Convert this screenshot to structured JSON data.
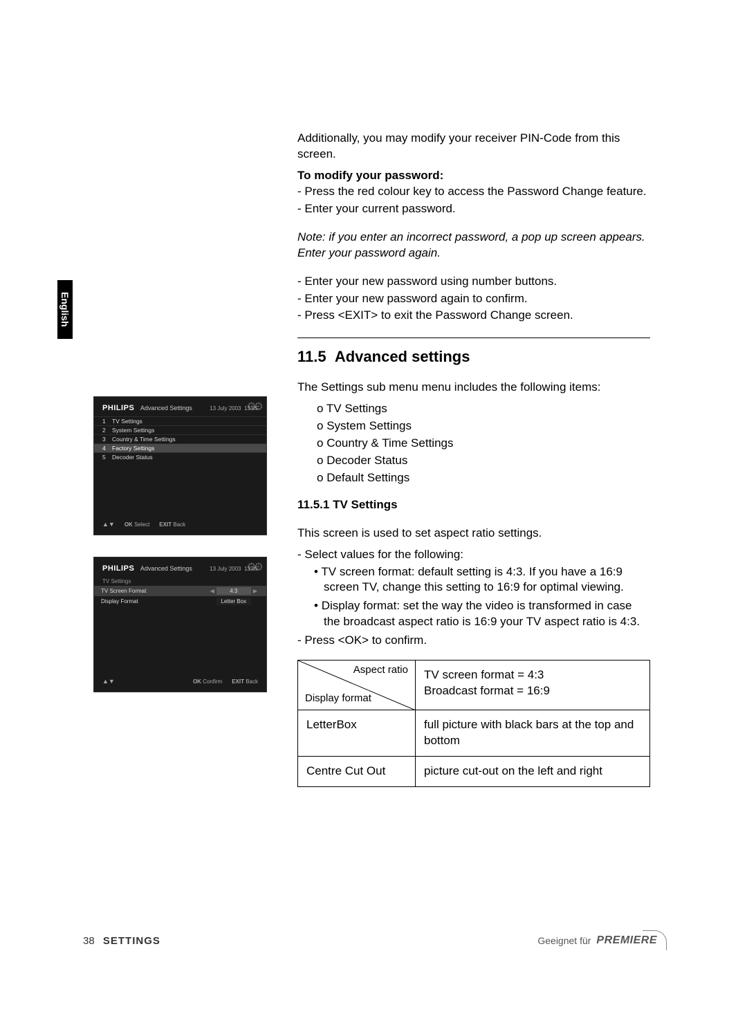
{
  "lang_tab": "English",
  "intro": "Additionally, you may modify your receiver PIN-Code from this screen.",
  "modify_heading": "To modify your password:",
  "modify_steps_1": [
    "Press the red colour key to access the Password Change feature.",
    "Enter your current password."
  ],
  "note": "Note: if you enter an incorrect password, a pop up screen appears. Enter your password again.",
  "modify_steps_2": [
    "Enter your new password using number buttons.",
    "Enter your new password again to confirm.",
    "Press <EXIT> to exit the Password Change screen."
  ],
  "sec_num": "11.5",
  "sec_title": "Advanced settings",
  "sec_intro": "The Settings sub menu menu includes the following items:",
  "sec_items": [
    "TV Settings",
    "System Settings",
    "Country & Time Settings",
    "Decoder Status",
    "Default Settings"
  ],
  "sub_num": "11.5.1",
  "sub_title": "TV Settings",
  "sub_intro": "This screen is used to set aspect ratio settings.",
  "sub_select": "Select values for the following:",
  "tv_bullets": [
    "TV screen format: default setting is 4:3. If you have a 16:9 screen TV, change this setting to 16:9 for optimal viewing.",
    "Display format: set the way the video is transformed in case the broadcast aspect ratio is 16:9 your TV aspect ratio is 4:3."
  ],
  "press_ok": "Press <OK> to confirm.",
  "table": {
    "col1_top": "Aspect ratio",
    "col1_bot": "Display format",
    "col2_line1": "TV screen format = 4:3",
    "col2_line2": "Broadcast format = 16:9",
    "row2_a": "LetterBox",
    "row2_b": "full picture with black bars at the top and bottom",
    "row3_a": "Centre Cut Out",
    "row3_b": "picture cut-out on the left and right"
  },
  "footer": {
    "page": "38",
    "title": "SETTINGS",
    "geeignet": "Geeignet für",
    "brand": "PREMIERE"
  },
  "shot1": {
    "brand": "PHILIPS",
    "title": "Advanced Settings",
    "date": "13 July 2003",
    "time": "13:05",
    "items": [
      {
        "n": "1",
        "t": "TV Settings"
      },
      {
        "n": "2",
        "t": "System Settings"
      },
      {
        "n": "3",
        "t": "Country & Time Settings"
      },
      {
        "n": "4",
        "t": "Factory Settings"
      },
      {
        "n": "5",
        "t": "Decoder Status"
      }
    ],
    "highlight_idx": 3,
    "f_select": "Select",
    "f_back": "Back",
    "f_ok": "OK",
    "f_exit": "EXIT"
  },
  "shot2": {
    "brand": "PHILIPS",
    "title": "Advanced Settings",
    "sub": "TV Settings",
    "date": "13 July 2003",
    "time": "13:05",
    "opt1_label": "TV Screen Format",
    "opt1_val": "4:3",
    "opt2_label": "Display Format",
    "opt2_val": "Letter Box",
    "f_confirm": "Confirm",
    "f_back": "Back",
    "f_ok": "OK",
    "f_exit": "EXIT"
  }
}
